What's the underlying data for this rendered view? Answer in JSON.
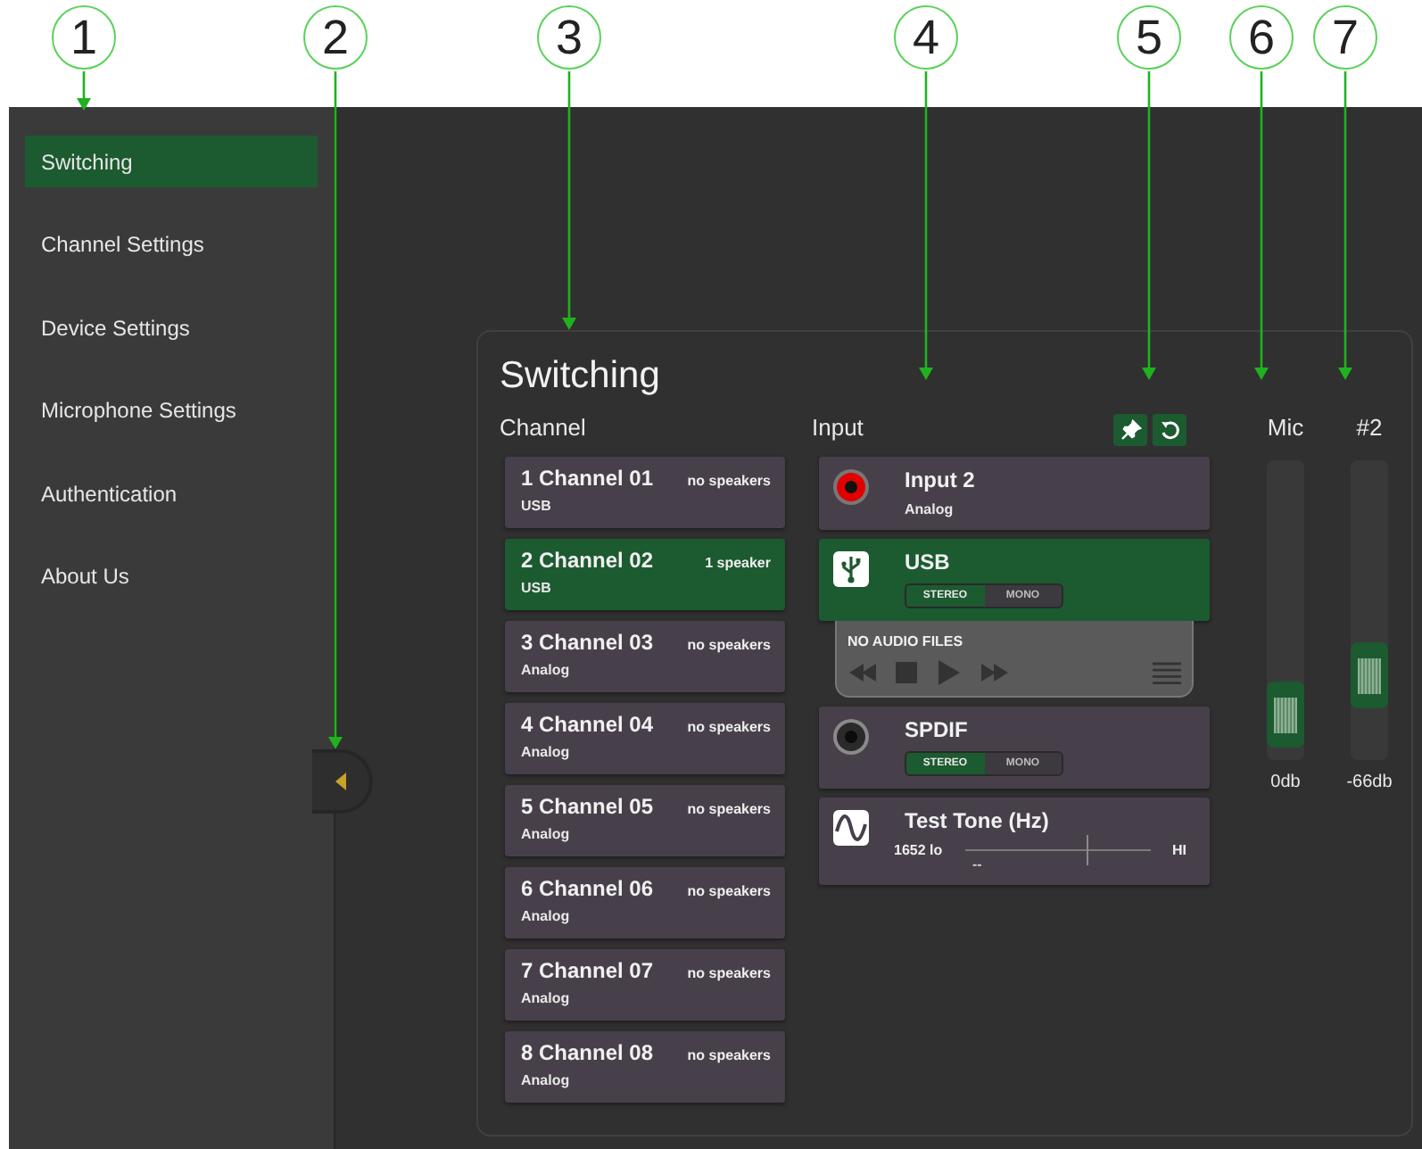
{
  "callouts": [
    {
      "label": "1"
    },
    {
      "label": "2"
    },
    {
      "label": "3"
    },
    {
      "label": "4"
    },
    {
      "label": "5"
    },
    {
      "label": "6"
    },
    {
      "label": "7"
    }
  ],
  "sidebar": {
    "items": [
      {
        "label": "Switching",
        "selected": true
      },
      {
        "label": "Channel Settings",
        "selected": false
      },
      {
        "label": "Device Settings",
        "selected": false
      },
      {
        "label": "Microphone Settings",
        "selected": false
      },
      {
        "label": "Authentication",
        "selected": false
      },
      {
        "label": "About Us",
        "selected": false
      }
    ]
  },
  "panel": {
    "title": "Switching",
    "channel_header": "Channel",
    "input_header": "Input",
    "channels": [
      {
        "name": "1 Channel 01",
        "speakers": "no speakers",
        "source": "USB",
        "selected": false
      },
      {
        "name": "2 Channel 02",
        "speakers": "1 speaker",
        "source": "USB",
        "selected": true
      },
      {
        "name": "3 Channel 03",
        "speakers": "no speakers",
        "source": "Analog",
        "selected": false
      },
      {
        "name": "4 Channel 04",
        "speakers": "no speakers",
        "source": "Analog",
        "selected": false
      },
      {
        "name": "5 Channel 05",
        "speakers": "no speakers",
        "source": "Analog",
        "selected": false
      },
      {
        "name": "6 Channel 06",
        "speakers": "no speakers",
        "source": "Analog",
        "selected": false
      },
      {
        "name": "7 Channel 07",
        "speakers": "no speakers",
        "source": "Analog",
        "selected": false
      },
      {
        "name": "8 Channel 08",
        "speakers": "no speakers",
        "source": "Analog",
        "selected": false
      }
    ],
    "inputs": [
      {
        "kind": "analog",
        "name": "Input 2",
        "subtitle": "Analog",
        "selected": false
      },
      {
        "kind": "usb",
        "name": "USB",
        "selected": true,
        "modes": [
          {
            "label": "STEREO",
            "selected": true
          },
          {
            "label": "MONO",
            "selected": false
          }
        ],
        "player": {
          "status": "NO AUDIO FILES"
        }
      },
      {
        "kind": "spdif",
        "name": "SPDIF",
        "selected": false,
        "modes": [
          {
            "label": "STEREO",
            "selected": true
          },
          {
            "label": "MONO",
            "selected": false
          }
        ]
      },
      {
        "kind": "tone",
        "name": "Test Tone (Hz)",
        "selected": false,
        "value": "1652 lo",
        "high_label": "HI",
        "scale_mark": "--",
        "level": 0.65
      }
    ],
    "faders": [
      {
        "label": "Mic",
        "reading": "0db",
        "level": 0.05
      },
      {
        "label": "#2",
        "reading": "-66db",
        "level": 0.22
      }
    ]
  }
}
